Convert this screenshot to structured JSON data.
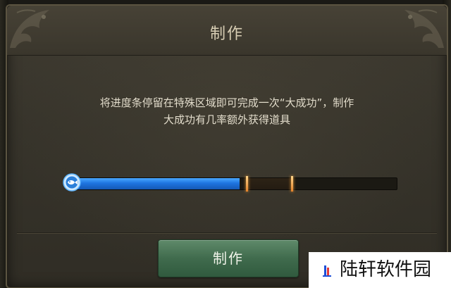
{
  "dialog": {
    "title": "制作",
    "description_lines": [
      "将进度条停留在特殊区域即可完成一次“大成功”，制作",
      "大成功有几率额外获得道具"
    ],
    "button_label": "制作"
  },
  "progress": {
    "fill_fraction": 0.52,
    "special_zone": [
      0.54,
      0.68
    ]
  },
  "watermark": {
    "text": "陆轩软件园"
  },
  "colors": {
    "panel": "#37342b",
    "title_text": "#d8ceb4",
    "progress_fill": "#1e74e0",
    "zone_marker": "#e3812a",
    "button": "#406b4d"
  },
  "icons": {
    "knob": "fish-icon",
    "corners": "dragon-ornament-icon",
    "watermark_logo": "lighthouse-logo-icon"
  }
}
